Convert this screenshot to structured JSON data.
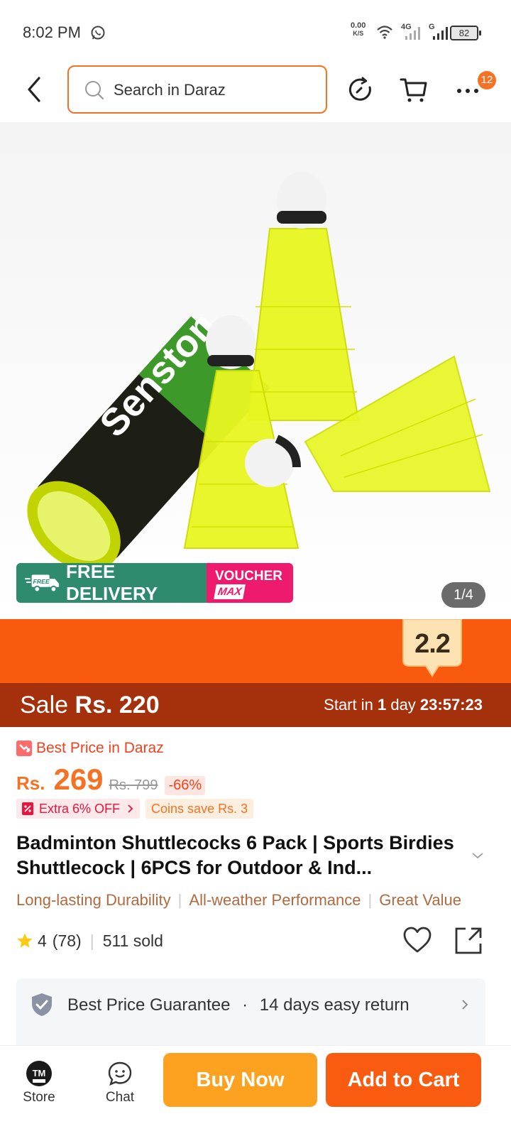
{
  "status_bar": {
    "time": "8:02 PM",
    "net_speed": "0.00",
    "net_unit": "K/S",
    "net_type_1": "4G",
    "net_type_2": "G",
    "battery": "82"
  },
  "header": {
    "search_placeholder": "Search in Daraz",
    "cart_badge": "12"
  },
  "gallery": {
    "brand_on_tube": "Senston",
    "free_delivery": "FREE DELIVERY",
    "free_tag": "FREE",
    "voucher_line1": "VOUCHER",
    "voucher_line2": "MAX",
    "counter": "1/4"
  },
  "campaign": {
    "badge": "2.2",
    "sale_label": "Sale",
    "sale_price": "Rs. 220",
    "start_prefix": "Start in ",
    "start_days": "1",
    "start_days_label": " day ",
    "countdown": "23:57:23"
  },
  "pricing": {
    "best_price": "Best Price in Daraz",
    "currency": "Rs.",
    "price": "269",
    "original_price": "Rs. 799",
    "discount": "-66%",
    "extra_off": "Extra 6% OFF",
    "coins_save": "Coins save Rs. 3"
  },
  "product": {
    "title": "Badminton Shuttlecocks 6 Pack | Sports Birdies Shuttlecock | 6PCS for Outdoor & Ind...",
    "features": [
      "Long-lasting Durability",
      "All-weather Performance",
      "Great Value"
    ],
    "rating": "4",
    "review_count": "(78)",
    "sold": "511 sold"
  },
  "guarantee": {
    "text_1": "Best Price Guarantee",
    "separator": "·",
    "text_2": "14 days easy return"
  },
  "bottom_bar": {
    "store_label": "Store",
    "chat_label": "Chat",
    "buy_now": "Buy Now",
    "add_to_cart": "Add to Cart"
  },
  "colors": {
    "accent": "#f57224",
    "campaign_orange": "#fa5a0e",
    "sale_bar": "#a5300c",
    "buy_now": "#fca220",
    "add_to_cart": "#f95b10"
  }
}
